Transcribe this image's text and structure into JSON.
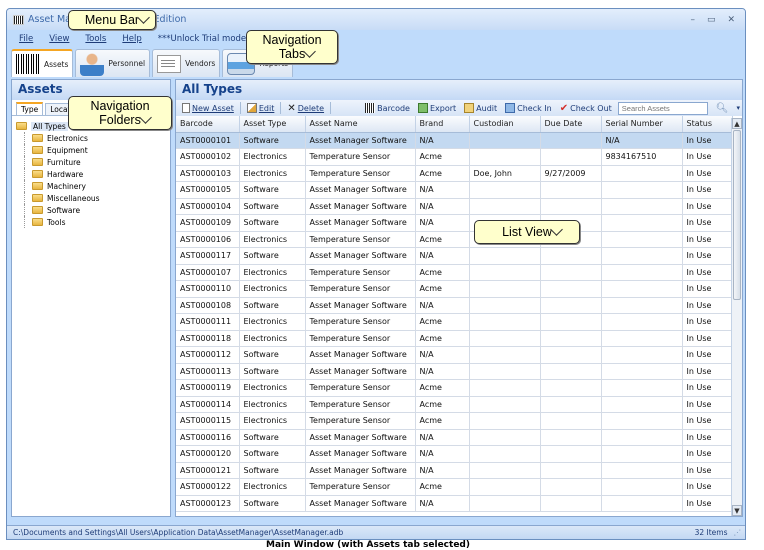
{
  "window": {
    "title": "Asset Manager Enterprise Edition",
    "controls": {
      "minimize": "–",
      "maximize": "▭",
      "close": "✕"
    }
  },
  "menu": {
    "items": [
      "File",
      "View",
      "Tools",
      "Help"
    ],
    "trial": "***Unlock Trial mode***"
  },
  "nav_tabs": [
    {
      "label": "Assets",
      "icon": "barcode-icon",
      "active": true
    },
    {
      "label": "Personnel",
      "icon": "person-icon"
    },
    {
      "label": "Vendors",
      "icon": "business-card-icon"
    },
    {
      "label": "Reports",
      "icon": "printer-icon"
    }
  ],
  "left_pane": {
    "title": "Assets",
    "tabs": [
      "Type",
      "Location"
    ],
    "tree": {
      "root": "All Types",
      "children": [
        "Electronics",
        "Equipment",
        "Furniture",
        "Hardware",
        "Machinery",
        "Miscellaneous",
        "Software",
        "Tools"
      ]
    }
  },
  "right_pane": {
    "title": "All Types",
    "toolbar": {
      "new_asset": "New Asset",
      "edit": "Edit",
      "delete": "Delete",
      "barcode": "Barcode",
      "export": "Export",
      "audit": "Audit",
      "check_in": "Check In",
      "check_out": "Check Out",
      "search_placeholder": "Search Assets"
    },
    "columns": [
      "Barcode",
      "Asset Type",
      "Asset Name",
      "Brand",
      "Custodian",
      "Due Date",
      "Serial Number",
      "Status"
    ],
    "rows": [
      [
        "AST0000101",
        "Software",
        "Asset Manager Software",
        "N/A",
        "",
        "",
        "N/A",
        "In Use"
      ],
      [
        "AST0000102",
        "Electronics",
        "Temperature Sensor",
        "Acme",
        "",
        "",
        "9834167510",
        "In Use"
      ],
      [
        "AST0000103",
        "Electronics",
        "Temperature Sensor",
        "Acme",
        "Doe, John",
        "9/27/2009",
        "",
        "In Use"
      ],
      [
        "AST0000105",
        "Software",
        "Asset Manager Software",
        "N/A",
        "",
        "",
        "",
        "In Use"
      ],
      [
        "AST0000104",
        "Software",
        "Asset Manager Software",
        "N/A",
        "",
        "",
        "",
        "In Use"
      ],
      [
        "AST0000109",
        "Software",
        "Asset Manager Software",
        "N/A",
        "",
        "",
        "",
        "In Use"
      ],
      [
        "AST0000106",
        "Electronics",
        "Temperature Sensor",
        "Acme",
        "",
        "",
        "",
        "In Use"
      ],
      [
        "AST0000117",
        "Software",
        "Asset Manager Software",
        "N/A",
        "",
        "",
        "",
        "In Use"
      ],
      [
        "AST0000107",
        "Electronics",
        "Temperature Sensor",
        "Acme",
        "",
        "",
        "",
        "In Use"
      ],
      [
        "AST0000110",
        "Electronics",
        "Temperature Sensor",
        "Acme",
        "",
        "",
        "",
        "In Use"
      ],
      [
        "AST0000108",
        "Software",
        "Asset Manager Software",
        "N/A",
        "",
        "",
        "",
        "In Use"
      ],
      [
        "AST0000111",
        "Electronics",
        "Temperature Sensor",
        "Acme",
        "",
        "",
        "",
        "In Use"
      ],
      [
        "AST0000118",
        "Electronics",
        "Temperature Sensor",
        "Acme",
        "",
        "",
        "",
        "In Use"
      ],
      [
        "AST0000112",
        "Software",
        "Asset Manager Software",
        "N/A",
        "",
        "",
        "",
        "In Use"
      ],
      [
        "AST0000113",
        "Software",
        "Asset Manager Software",
        "N/A",
        "",
        "",
        "",
        "In Use"
      ],
      [
        "AST0000119",
        "Electronics",
        "Temperature Sensor",
        "Acme",
        "",
        "",
        "",
        "In Use"
      ],
      [
        "AST0000114",
        "Electronics",
        "Temperature Sensor",
        "Acme",
        "",
        "",
        "",
        "In Use"
      ],
      [
        "AST0000115",
        "Electronics",
        "Temperature Sensor",
        "Acme",
        "",
        "",
        "",
        "In Use"
      ],
      [
        "AST0000116",
        "Software",
        "Asset Manager Software",
        "N/A",
        "",
        "",
        "",
        "In Use"
      ],
      [
        "AST0000120",
        "Software",
        "Asset Manager Software",
        "N/A",
        "",
        "",
        "",
        "In Use"
      ],
      [
        "AST0000121",
        "Software",
        "Asset Manager Software",
        "N/A",
        "",
        "",
        "",
        "In Use"
      ],
      [
        "AST0000122",
        "Electronics",
        "Temperature Sensor",
        "Acme",
        "",
        "",
        "",
        "In Use"
      ],
      [
        "AST0000123",
        "Software",
        "Asset Manager Software",
        "N/A",
        "",
        "",
        "",
        "In Use"
      ]
    ],
    "selected_row": 0
  },
  "status_bar": {
    "path": "C:\\Documents and Settings\\All Users\\Application Data\\AssetManager\\AssetManager.adb",
    "count": "32 Items"
  },
  "callouts": {
    "menu_bar": "Menu Bar",
    "navigation_tabs": "Navigation Tabs",
    "navigation_folders": "Navigation Folders",
    "list_view": "List View"
  },
  "caption": "Main Window (with Assets tab selected)"
}
